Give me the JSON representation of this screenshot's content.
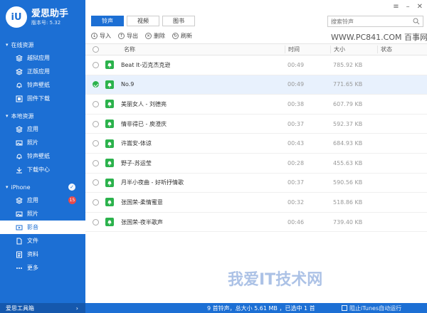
{
  "app": {
    "name": "爱思助手",
    "version": "版本号: 5.32",
    "logo_text": "iU"
  },
  "sidebar": {
    "online_section": "在线资源",
    "online_items": [
      "越狱应用",
      "正版应用",
      "铃声壁纸",
      "固件下载"
    ],
    "local_section": "本地资源",
    "local_items": [
      "应用",
      "照片",
      "铃声壁纸",
      "下载中心"
    ],
    "device_section": "iPhone",
    "device_items": [
      "应用",
      "照片",
      "影音",
      "文件",
      "资料",
      "更多"
    ],
    "device_app_badge": "15",
    "toolbox": "爱思工具箱"
  },
  "tabs": [
    "铃声",
    "视频",
    "图书"
  ],
  "search": {
    "placeholder": "搜索铃声"
  },
  "watermark": "WWW.PC841.COM 百事网",
  "watermark2": "我爱IT技术网",
  "actions": {
    "import": "导入",
    "export": "导出",
    "delete": "删除",
    "refresh": "刷新"
  },
  "table": {
    "headers": {
      "name": "名称",
      "time": "时间",
      "size": "大小",
      "status": "状态"
    },
    "rows": [
      {
        "name": "Beat It-迈克杰克逊",
        "time": "00:49",
        "size": "785.92 KB",
        "selected": false
      },
      {
        "name": "No.9",
        "time": "00:49",
        "size": "771.65 KB",
        "selected": true
      },
      {
        "name": "美丽女人 - 刘德亮",
        "time": "00:38",
        "size": "607.79 KB",
        "selected": false
      },
      {
        "name": "情非得已 - 庾澄庆",
        "time": "00:37",
        "size": "592.37 KB",
        "selected": false
      },
      {
        "name": "许嵩安-体谅",
        "time": "00:43",
        "size": "684.93 KB",
        "selected": false
      },
      {
        "name": "野子-苏运莹",
        "time": "00:28",
        "size": "455.63 KB",
        "selected": false
      },
      {
        "name": "月半小夜曲 - 好听抒情歌",
        "time": "00:37",
        "size": "590.56 KB",
        "selected": false
      },
      {
        "name": "张国荣-柔情蜜意",
        "time": "00:32",
        "size": "518.86 KB",
        "selected": false
      },
      {
        "name": "张国荣-夜半歌声",
        "time": "00:46",
        "size": "739.40 KB",
        "selected": false
      }
    ]
  },
  "statusbar": {
    "summary": "9 首铃声，总大小 5.61 MB ，已选中 1 首",
    "itunes": "阻止iTunes自动运行"
  },
  "colors": {
    "accent": "#1c6fd4",
    "green": "#2bb24c",
    "badge": "#e84a4a"
  }
}
